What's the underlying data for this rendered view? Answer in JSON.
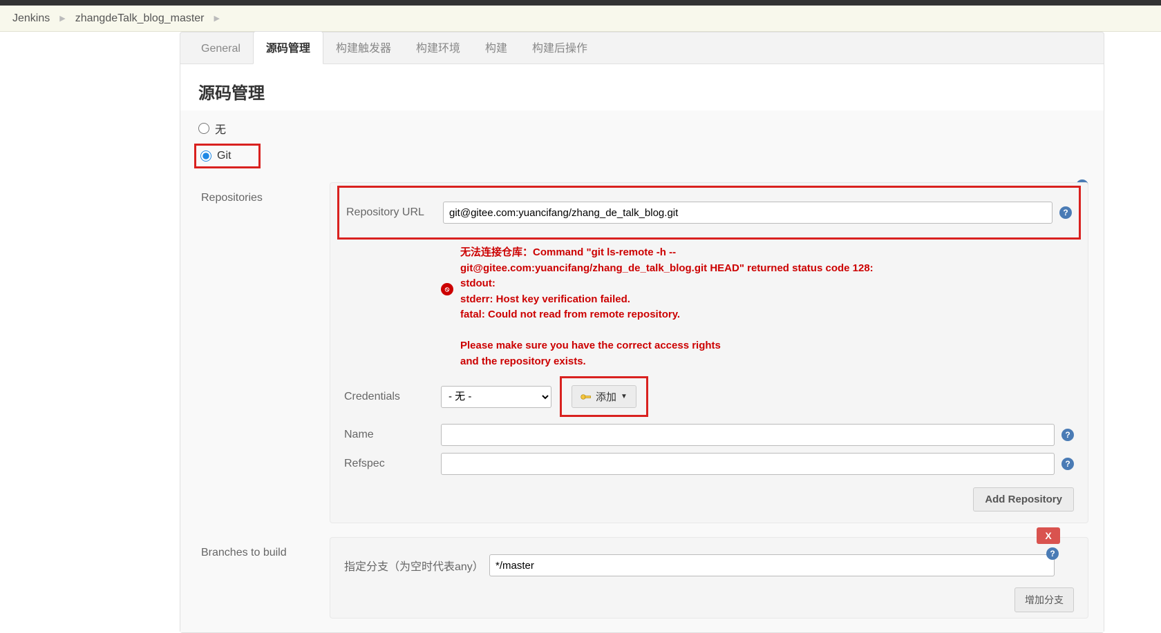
{
  "breadcrumb": {
    "root": "Jenkins",
    "job": "zhangdeTalk_blog_master"
  },
  "tabs": {
    "general": "General",
    "scm": "源码管理",
    "triggers": "构建触发器",
    "env": "构建环境",
    "build": "构建",
    "post": "构建后操作"
  },
  "section": {
    "heading": "源码管理"
  },
  "scm_radio": {
    "none_label": "无",
    "git_label": "Git"
  },
  "side": {
    "repositories": "Repositories",
    "branches": "Branches to build"
  },
  "repo": {
    "url_label": "Repository URL",
    "url_value": "git@gitee.com:yuancifang/zhang_de_talk_blog.git",
    "credentials_label": "Credentials",
    "credentials_value": "- 无 -",
    "add_button": "添加",
    "name_label": "Name",
    "name_value": "",
    "refspec_label": "Refspec",
    "refspec_value": "",
    "add_repo_button": "Add Repository"
  },
  "error": {
    "text": "无法连接仓库：Command \"git ls-remote -h --\ngit@gitee.com:yuancifang/zhang_de_talk_blog.git HEAD\" returned status code 128:\nstdout:\nstderr: Host key verification failed.\nfatal: Could not read from remote repository.\n\nPlease make sure you have the correct access rights\nand the repository exists."
  },
  "branch": {
    "spec_label": "指定分支（为空时代表any）",
    "spec_value": "*/master",
    "delete_label": "X",
    "add_branch_button": "增加分支"
  }
}
